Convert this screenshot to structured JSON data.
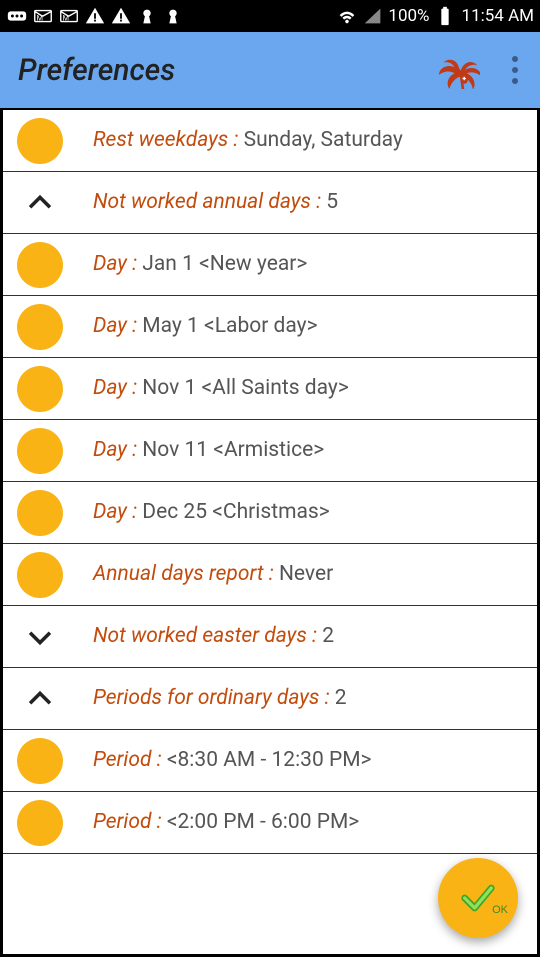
{
  "status": {
    "battery": "100%",
    "time": "11:54 AM"
  },
  "appbar": {
    "title": "Preferences"
  },
  "rows": [
    {
      "icon": "bullet",
      "label": "Rest weekdays : ",
      "value": "Sunday, Saturday"
    },
    {
      "icon": "chevron-up",
      "label": "Not worked annual days : ",
      "value": " 5"
    },
    {
      "icon": "bullet",
      "label": "Day : ",
      "value": "Jan 1 <New year>"
    },
    {
      "icon": "bullet",
      "label": "Day : ",
      "value": "May 1 <Labor day>"
    },
    {
      "icon": "bullet",
      "label": "Day : ",
      "value": "Nov 1 <All Saints day>"
    },
    {
      "icon": "bullet",
      "label": "Day : ",
      "value": "Nov 11 <Armistice>"
    },
    {
      "icon": "bullet",
      "label": "Day : ",
      "value": "Dec 25 <Christmas>"
    },
    {
      "icon": "bullet",
      "label": "Annual days report : ",
      "value": "Never"
    },
    {
      "icon": "chevron-down",
      "label": "Not worked easter days : ",
      "value": "2"
    },
    {
      "icon": "chevron-up",
      "label": "Periods for ordinary days : ",
      "value": " 2"
    },
    {
      "icon": "bullet",
      "label": "Period : ",
      "value": " <8:30 AM - 12:30 PM>"
    },
    {
      "icon": "bullet",
      "label": "Period : ",
      "value": " <2:00 PM - 6:00 PM>"
    }
  ],
  "fab": {
    "ok": "OK"
  }
}
